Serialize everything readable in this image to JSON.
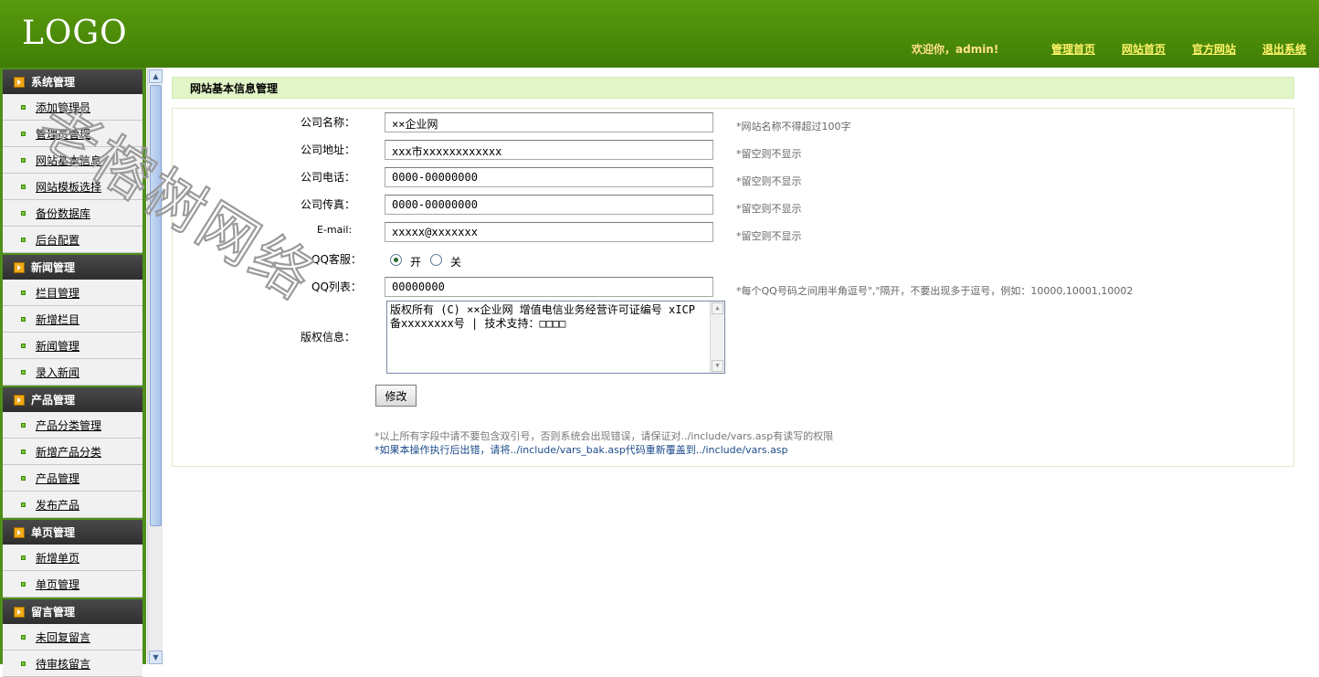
{
  "header": {
    "logo": "LOGO",
    "welcome": "欢迎你，admin!",
    "links": [
      "管理首页",
      "网站首页",
      "官方网站",
      "退出系统"
    ]
  },
  "sidebar": {
    "groups": [
      {
        "title": "系统管理",
        "items": [
          "添加管理员",
          "管理员管理",
          "网站基本信息",
          "网站模板选择",
          "备份数据库",
          "后台配置"
        ]
      },
      {
        "title": "新闻管理",
        "items": [
          "栏目管理",
          "新增栏目",
          "新闻管理",
          "录入新闻"
        ]
      },
      {
        "title": "产品管理",
        "items": [
          "产品分类管理",
          "新增产品分类",
          "产品管理",
          "发布产品"
        ]
      },
      {
        "title": "单页管理",
        "items": [
          "新增单页",
          "单页管理"
        ]
      },
      {
        "title": "留言管理",
        "items": [
          "未回复留言",
          "待审核留言"
        ]
      }
    ]
  },
  "main": {
    "title": "网站基本信息管理",
    "fields": {
      "company_name": {
        "label": "公司名称：",
        "value": "××企业网",
        "hint": "*网站名称不得超过100字"
      },
      "company_address": {
        "label": "公司地址：",
        "value": "xxx市xxxxxxxxxxxx",
        "hint": "*留空则不显示"
      },
      "company_phone": {
        "label": "公司电话：",
        "value": "0000-00000000",
        "hint": "*留空则不显示"
      },
      "company_fax": {
        "label": "公司传真：",
        "value": "0000-00000000",
        "hint": "*留空则不显示"
      },
      "email": {
        "label": "E-mail:",
        "value": "xxxxx@xxxxxxx",
        "hint": "*留空则不显示"
      },
      "qq_service": {
        "label": "QQ客服：",
        "on_label": "开",
        "off_label": "关",
        "selected": "开"
      },
      "qq_list": {
        "label": "QQ列表：",
        "value": "00000000",
        "hint": "*每个QQ号码之间用半角逗号\",\"隔开，不要出现多于逗号，例如：10000,10001,10002"
      },
      "copyright": {
        "label": "版权信息：",
        "value": "版权所有 (C) ××企业网  增值电信业务经营许可证编号  xICP备xxxxxxxx号  |  技术支持：□□□□"
      }
    },
    "submit_label": "修改",
    "note1": "*以上所有字段中请不要包含双引号，否则系统会出现错误，请保证对../include/vars.asp有读写的权限",
    "note2": "*如果本操作执行后出错，请将../include/vars_bak.asp代码重新覆盖到../include/vars.asp"
  },
  "watermark": "老榕树网络",
  "colors": {
    "header": "#4a8a08",
    "title_bar": "#e2f5c8",
    "sidebar": "#4e8f1a"
  }
}
